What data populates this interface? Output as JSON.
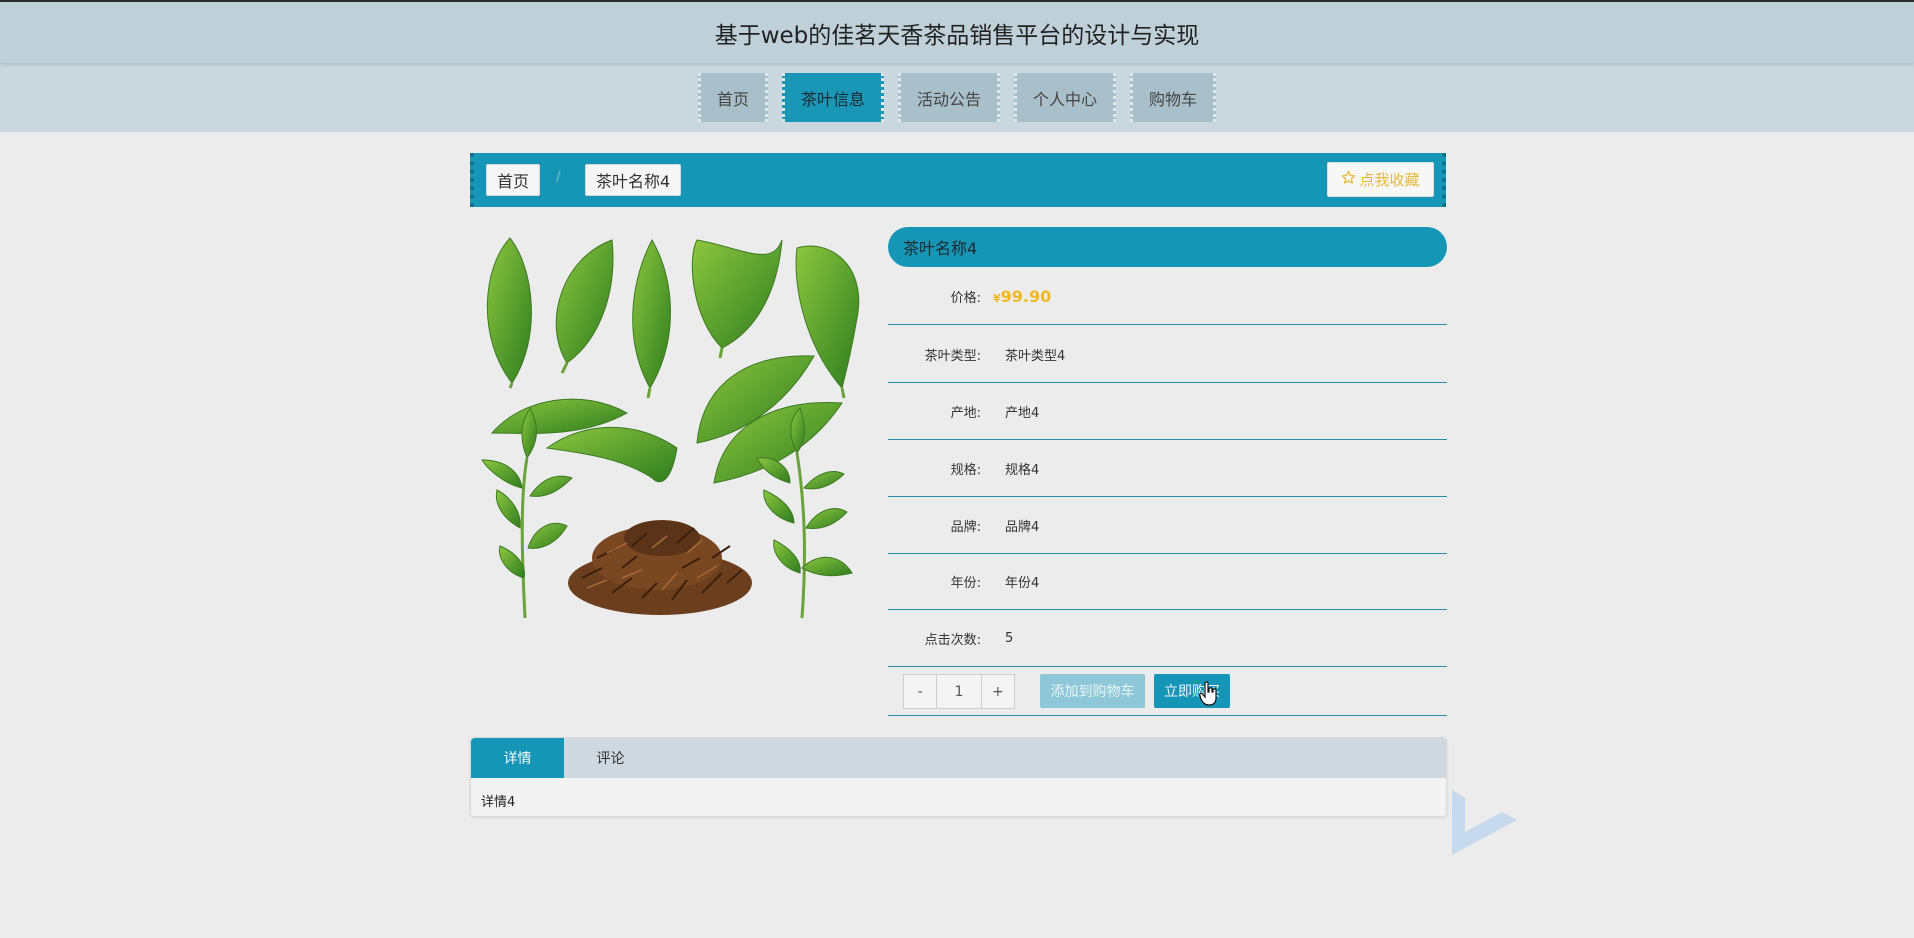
{
  "page_title": "基于web的佳茗天香茶品销售平台的设计与实现",
  "nav": {
    "items": [
      {
        "label": "首页"
      },
      {
        "label": "茶叶信息"
      },
      {
        "label": "活动公告"
      },
      {
        "label": "个人中心"
      },
      {
        "label": "购物车"
      }
    ],
    "active": "茶叶信息"
  },
  "breadcrumb": {
    "home": "首页",
    "separator": "/",
    "current": "茶叶名称4"
  },
  "favorite_button": {
    "icon": "star-outline-icon",
    "label": "点我收藏"
  },
  "product": {
    "name": "茶叶名称4",
    "price_label": "价格:",
    "currency": "¥",
    "price": "99.90",
    "details": [
      {
        "label": "茶叶类型:",
        "value": "茶叶类型4"
      },
      {
        "label": "产地:",
        "value": "产地4"
      },
      {
        "label": "规格:",
        "value": "规格4"
      },
      {
        "label": "品牌:",
        "value": "品牌4"
      },
      {
        "label": "年份:",
        "value": "年份4"
      },
      {
        "label": "点击次数:",
        "value": "5"
      }
    ]
  },
  "quantity": {
    "minus": "-",
    "value": "1",
    "plus": "+"
  },
  "actions": {
    "add_to_cart": "添加到购物车",
    "buy_now": "立即购买"
  },
  "tabs": {
    "items": [
      {
        "label": "详情"
      },
      {
        "label": "评论"
      }
    ],
    "active": "详情",
    "content": "详情4"
  },
  "colors": {
    "primary": "#1596b6",
    "price": "#f2b81f",
    "title_bar": "#bfd0d9",
    "nav_bar": "#cbd7df",
    "nav_item": "#a9bfc9"
  }
}
